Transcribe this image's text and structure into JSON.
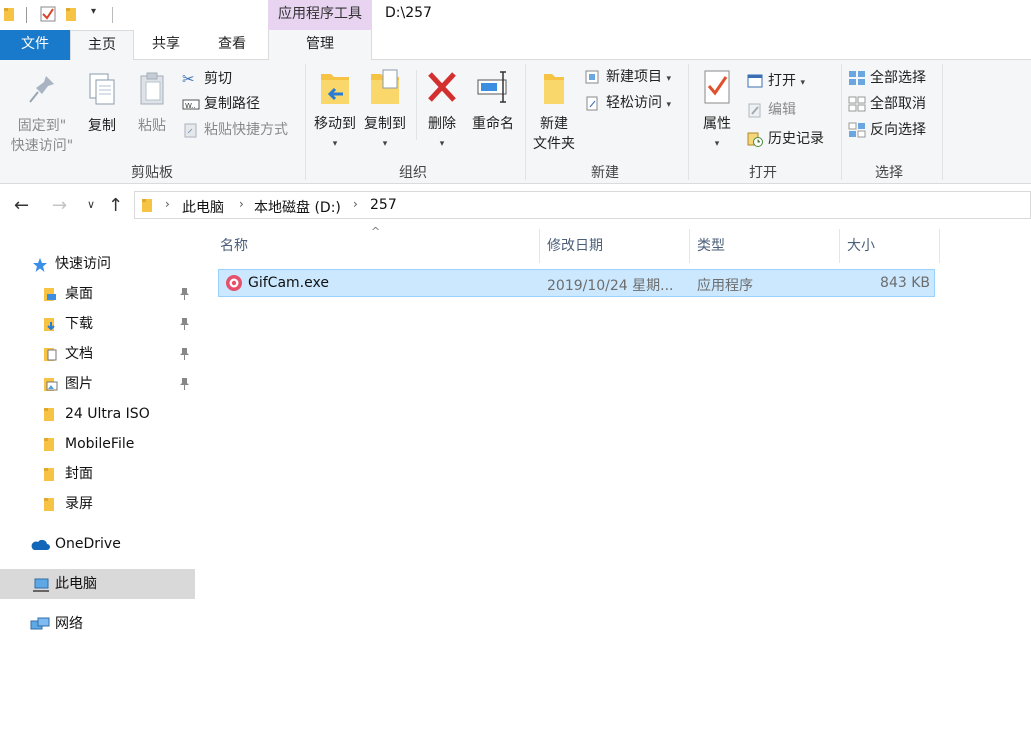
{
  "titlebar": {
    "context_tool_label": "应用程序工具",
    "window_path": "D:\\257"
  },
  "tabs": {
    "file": "文件",
    "home": "主页",
    "share": "共享",
    "view": "查看",
    "manage": "管理"
  },
  "ribbon": {
    "clipboard": {
      "pin_line1": "固定到\"",
      "pin_line2": "快速访问\"",
      "copy": "复制",
      "paste": "粘贴",
      "cut": "剪切",
      "copy_path": "复制路径",
      "paste_shortcut": "粘贴快捷方式",
      "group_label": "剪贴板"
    },
    "organize": {
      "move_to": "移动到",
      "copy_to": "复制到",
      "delete": "删除",
      "rename": "重命名",
      "group_label": "组织"
    },
    "new": {
      "new_folder_line1": "新建",
      "new_folder_line2": "文件夹",
      "new_item": "新建项目",
      "easy_access": "轻松访问",
      "group_label": "新建"
    },
    "open": {
      "properties": "属性",
      "open": "打开",
      "edit": "编辑",
      "history": "历史记录",
      "group_label": "打开"
    },
    "select": {
      "select_all": "全部选择",
      "select_none": "全部取消",
      "invert": "反向选择",
      "group_label": "选择"
    }
  },
  "address": {
    "crumbs": [
      "此电脑",
      "本地磁盘 (D:)",
      "257"
    ]
  },
  "nav": {
    "quick_access": "快速访问",
    "items": [
      "桌面",
      "下载",
      "文档",
      "图片",
      "24 Ultra ISO",
      "MobileFile",
      "封面",
      "录屏"
    ],
    "onedrive": "OneDrive",
    "this_pc": "此电脑",
    "network": "网络"
  },
  "columns": {
    "name": "名称",
    "modified": "修改日期",
    "type": "类型",
    "size": "大小"
  },
  "files": [
    {
      "name": "GifCam.exe",
      "modified": "2019/10/24 星期...",
      "type": "应用程序",
      "size": "843 KB"
    }
  ],
  "colors": {
    "file_tab": "#1979ca",
    "context_tab": "#e8d3f1",
    "selection": "#cce8ff",
    "nav_selected": "#d9d9d9"
  }
}
